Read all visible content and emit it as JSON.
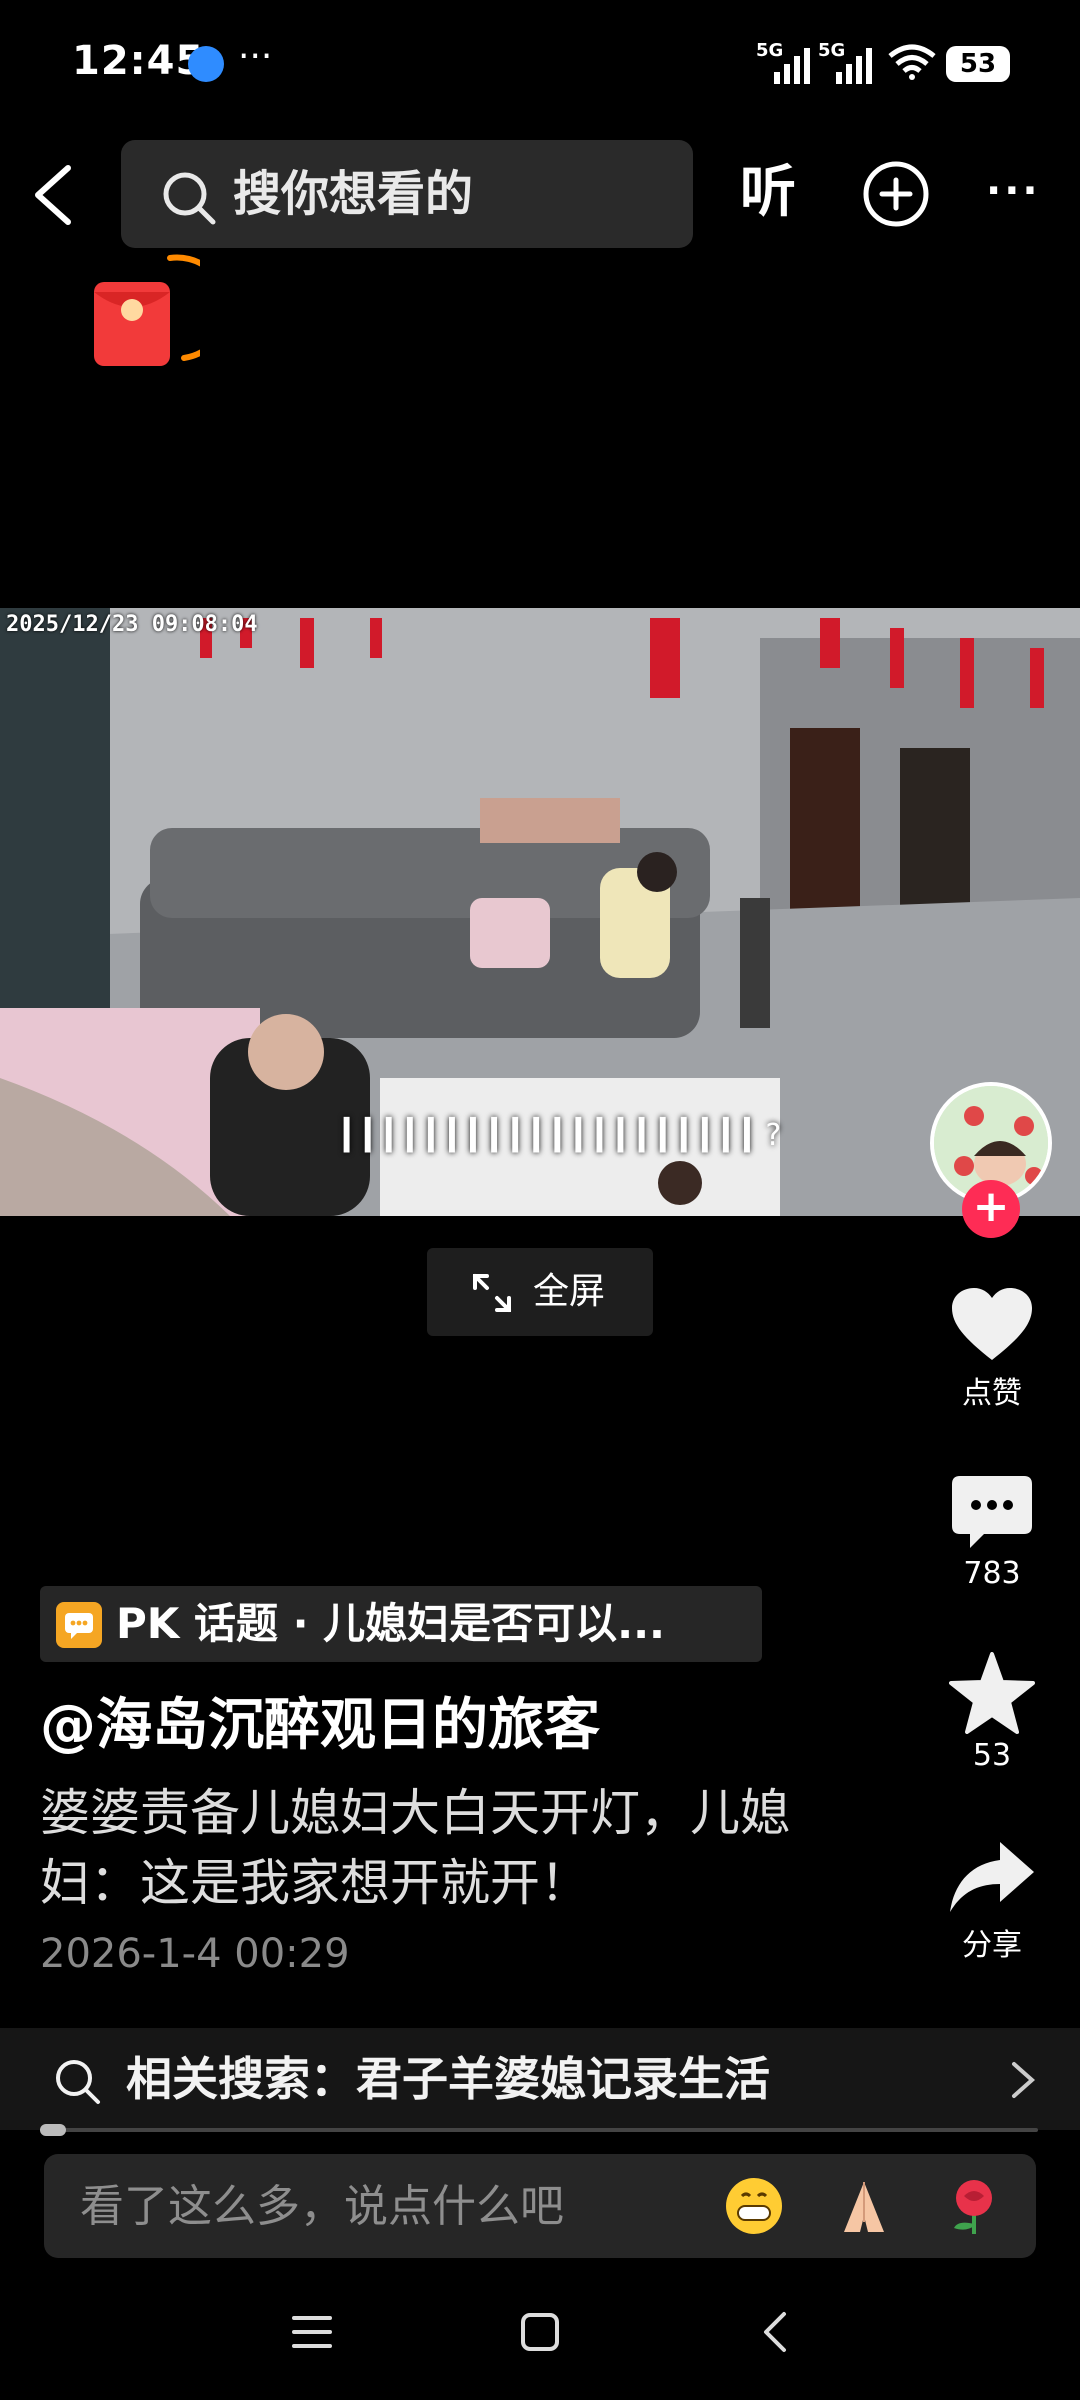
{
  "status_bar": {
    "time": "12:45",
    "more": "···",
    "signal_1": "5G",
    "signal_2": "5G",
    "battery": "53"
  },
  "top_bar": {
    "search_placeholder": "搜你想看的",
    "listen_label": "听",
    "more_label": "···"
  },
  "video": {
    "timestamp": "2025/12/23 09:08:04",
    "overlay_text": "▎▎▎▎▎▎▎▎▎▎▎▎▎▎▎▎▎▎▎▎?"
  },
  "fullscreen": {
    "label": "全屏"
  },
  "actions": {
    "like_label": "点赞",
    "comment_count": "783",
    "favorite_count": "53",
    "share_label": "分享"
  },
  "post": {
    "topic": "PK 话题 · 儿媳妇是否可以...",
    "author": "@海岛沉醉观日的旅客",
    "description": "婆婆责备儿媳妇大白天开灯，儿媳妇：这是我家想开就开！",
    "datetime": "2026-1-4 00:29"
  },
  "related_search": {
    "text": "相关搜索：君子羊婆媳记录生活"
  },
  "comment_bar": {
    "placeholder": "看了这么多，说点什么吧"
  },
  "colors": {
    "accent_red": "#fe2c55",
    "topic_orange": "#f5a623",
    "background": "#000000"
  }
}
